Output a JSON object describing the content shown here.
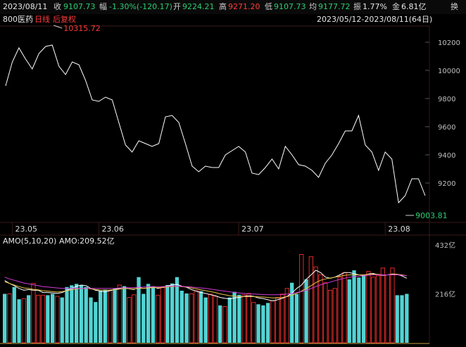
{
  "header": {
    "date": "2023/08/11",
    "close_label": "收",
    "close": "9107.73",
    "change_label": "幅",
    "change": "-1.30%(-120.17)",
    "open_label": "开",
    "open": "9224.21",
    "high_label": "高",
    "high": "9271.20",
    "low_label": "低",
    "low": "9107.73",
    "avg_label": "均",
    "avg": "9177.72",
    "amplitude_label": "振",
    "amplitude": "1.77%",
    "amount_label": "金",
    "amount": "6.81亿",
    "switch_label": "换"
  },
  "subheader": {
    "name": "800医药",
    "period": "日线",
    "adjust": "后复权",
    "range": "2023/05/12-2023/08/11(64日)"
  },
  "colors": {
    "price_line": "#ffffff",
    "up": "#ff3b3b",
    "down": "#2ecc71",
    "bar_up_edge": "#e02a2a",
    "bar_down": "#52d3d3",
    "ma5": "#ffffff",
    "ma10": "#e8c34a",
    "ma20": "#d63ad6",
    "grid": "#2a1212"
  },
  "chart_data": [
    {
      "type": "line",
      "title": "800医药",
      "ylim": [
        9000,
        10300
      ],
      "yticks": [
        "10200",
        "10000",
        "9800",
        "9600",
        "9400",
        "9200"
      ],
      "x_labels": [
        {
          "index": 1,
          "label": "23.05"
        },
        {
          "index": 14,
          "label": "23.06"
        },
        {
          "index": 35,
          "label": "23.07"
        },
        {
          "index": 57,
          "label": "23.08"
        }
      ],
      "series": [
        {
          "values": [
            9890,
            10060,
            10160,
            10080,
            10010,
            10120,
            10170,
            10180,
            10030,
            9970,
            10060,
            10040,
            9930,
            9790,
            9780,
            9810,
            9790,
            9630,
            9470,
            9420,
            9500,
            9480,
            9460,
            9480,
            9670,
            9680,
            9630,
            9480,
            9320,
            9280,
            9320,
            9310,
            9310,
            9400,
            9430,
            9460,
            9420,
            9270,
            9260,
            9310,
            9370,
            9300,
            9460,
            9400,
            9330,
            9320,
            9290,
            9240,
            9340,
            9400,
            9480,
            9570,
            9570,
            9680,
            9470,
            9420,
            9290,
            9420,
            9370,
            9060,
            9110,
            9230,
            9230,
            9110
          ]
        }
      ],
      "annotations": [
        {
          "text": "10315.72",
          "type": "high"
        },
        {
          "text": "9003.81",
          "type": "low"
        }
      ]
    },
    {
      "type": "bar",
      "title": "AMO(5,10,20)",
      "value_label": "AMO:209.52亿",
      "ylim": [
        0,
        432
      ],
      "yticks": [
        "432亿",
        "216亿"
      ],
      "series": [
        {
          "name": "AMO",
          "values": [
            216,
            216,
            246,
            192,
            195,
            210,
            262,
            210,
            210,
            210,
            216,
            205,
            200,
            246,
            254,
            260,
            254,
            246,
            200,
            180,
            230,
            235,
            230,
            240,
            255,
            250,
            200,
            212,
            290,
            216,
            260,
            248,
            210,
            246,
            255,
            262,
            290,
            230,
            218,
            216,
            230,
            228,
            200,
            215,
            205,
            165,
            160,
            200,
            225,
            212,
            212,
            218,
            178,
            170,
            165,
            176,
            185,
            200,
            215,
            240,
            265,
            215,
            390,
            280,
            380,
            335,
            300,
            265,
            232,
            240,
            290,
            310,
            280,
            320,
            288,
            300,
            315,
            290,
            296,
            330,
            300,
            330,
            210,
            210,
            216
          ],
          "up": [
            false,
            true,
            false,
            false,
            true,
            false,
            true,
            true,
            true,
            false,
            false,
            true,
            false,
            false,
            false,
            false,
            false,
            false,
            false,
            false,
            false,
            false,
            true,
            false,
            true,
            false,
            true,
            true,
            false,
            false,
            false,
            false,
            true,
            true,
            false,
            false,
            false,
            false,
            false,
            true,
            true,
            false,
            false,
            true,
            true,
            false,
            true,
            false,
            false,
            false,
            true,
            true,
            true,
            false,
            false,
            false,
            true,
            true,
            true,
            true,
            false,
            false,
            true,
            false,
            true,
            true,
            true,
            true,
            true,
            true,
            true,
            true,
            false,
            false,
            false,
            false,
            true,
            true,
            true,
            true,
            true,
            true,
            false,
            false,
            false
          ]
        }
      ],
      "ma_lines": [
        {
          "name": "MA5",
          "values": [
            275,
            262,
            252,
            240,
            232,
            235,
            232,
            232,
            222,
            222,
            220,
            218,
            222,
            232,
            240,
            250,
            255,
            252,
            240,
            232,
            228,
            225,
            230,
            236,
            240,
            245,
            238,
            236,
            244,
            240,
            242,
            248,
            240,
            245,
            252,
            255,
            258,
            250,
            245,
            235,
            228,
            222,
            218,
            212,
            208,
            200,
            196,
            194,
            198,
            200,
            205,
            208,
            205,
            198,
            195,
            190,
            185,
            190,
            196,
            205,
            220,
            240,
            255,
            280,
            300,
            320,
            310,
            290,
            285,
            290,
            300,
            310,
            310,
            305,
            300,
            298,
            304,
            306,
            300,
            298,
            300,
            304,
            302,
            295,
            285
          ]
        },
        {
          "name": "MA10",
          "values": [
            270,
            262,
            255,
            248,
            242,
            240,
            236,
            234,
            230,
            228,
            226,
            224,
            226,
            230,
            234,
            238,
            240,
            240,
            238,
            235,
            233,
            232,
            233,
            235,
            237,
            240,
            239,
            238,
            240,
            241,
            242,
            244,
            243,
            244,
            246,
            248,
            250,
            248,
            246,
            242,
            238,
            234,
            230,
            226,
            222,
            216,
            212,
            208,
            206,
            204,
            204,
            204,
            204,
            203,
            202,
            200,
            198,
            198,
            200,
            204,
            210,
            218,
            228,
            240,
            252,
            266,
            276,
            282,
            286,
            290,
            294,
            298,
            300,
            300,
            300,
            300,
            302,
            303,
            302,
            300,
            300,
            302,
            302,
            300,
            296
          ]
        },
        {
          "name": "MA20",
          "values": [
            290,
            282,
            276,
            270,
            264,
            260,
            256,
            252,
            248,
            246,
            244,
            242,
            240,
            240,
            240,
            240,
            240,
            240,
            240,
            240,
            240,
            240,
            240,
            240,
            242,
            243,
            243,
            244,
            245,
            246,
            247,
            248,
            248,
            248,
            249,
            250,
            250,
            249,
            248,
            246,
            244,
            242,
            240,
            237,
            234,
            231,
            228,
            225,
            222,
            220,
            218,
            216,
            215,
            214,
            213,
            212,
            212,
            212,
            213,
            215,
            218,
            222,
            226,
            232,
            240,
            248,
            256,
            262,
            268,
            274,
            280,
            285,
            290,
            292,
            294,
            296,
            298,
            300,
            300,
            300,
            300,
            300,
            300,
            298,
            296
          ]
        }
      ]
    }
  ]
}
